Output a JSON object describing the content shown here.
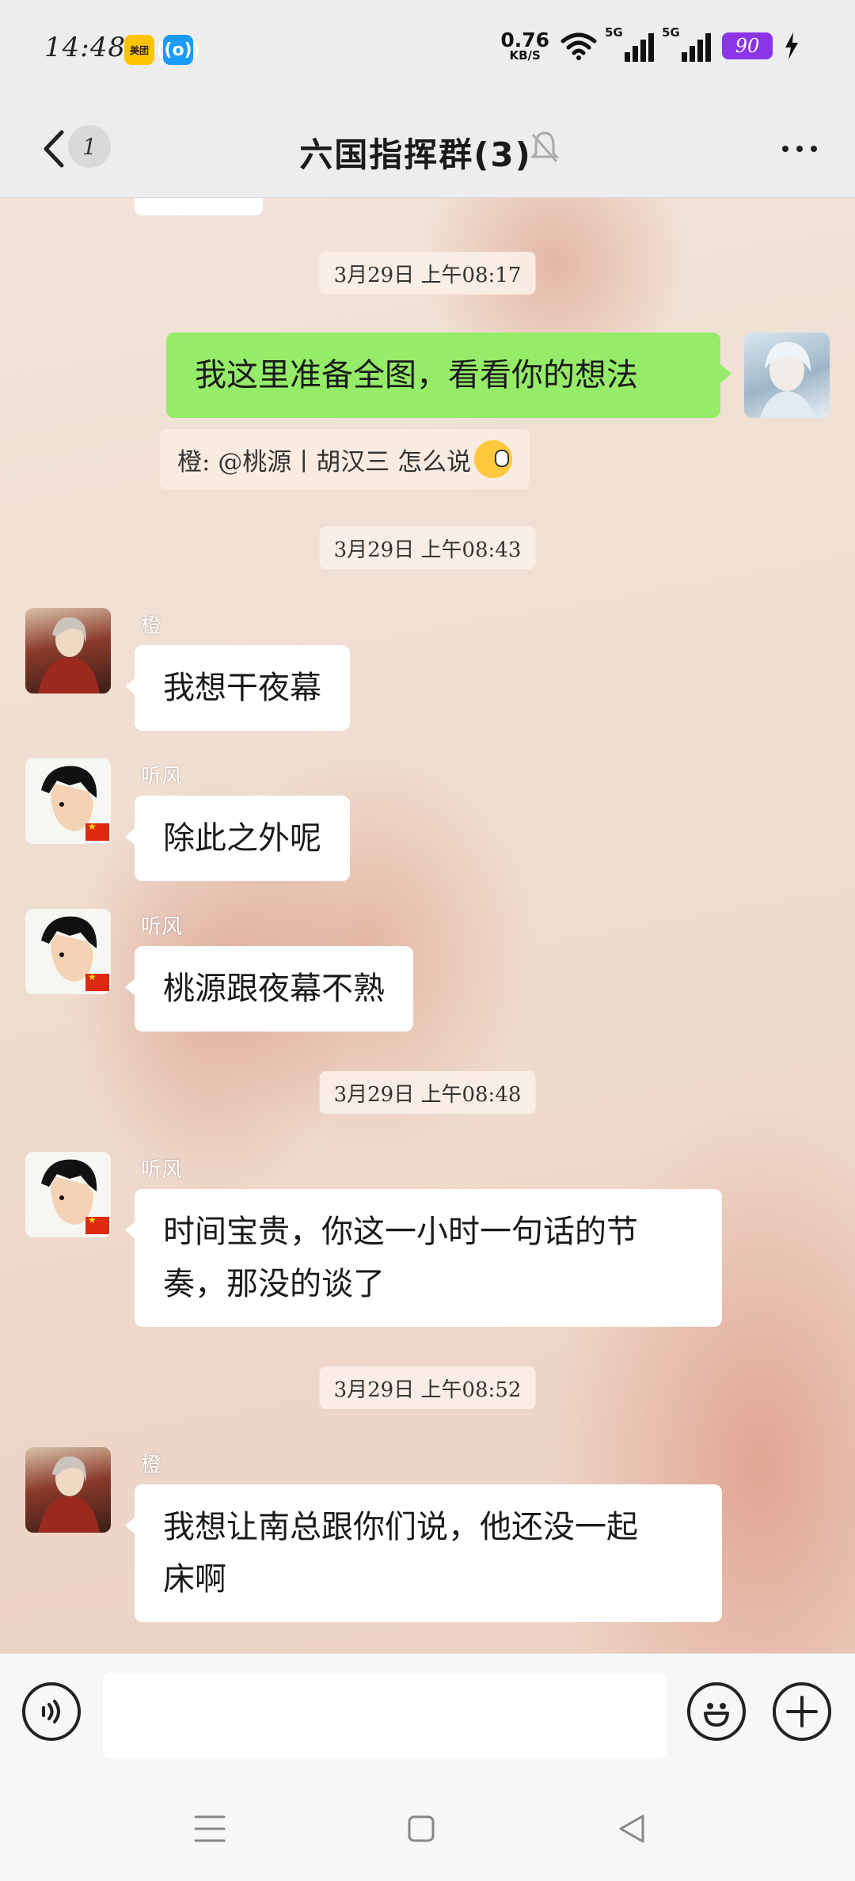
{
  "status_bar": {
    "time": "14:48",
    "app_badges": [
      "美团",
      "((o))"
    ],
    "net_speed_value": "0.76",
    "net_speed_unit": "KB/S",
    "signal_1": "5G",
    "signal_2": "5G",
    "battery": "90"
  },
  "header": {
    "unread_count": "1",
    "title": "六国指挥群(3)"
  },
  "messages": {
    "ts1": "3月29日 上午08:17",
    "m1_text": "我这里准备全图，看看你的想法",
    "m1_quote": "橙: @桃源丨胡汉三 怎么说",
    "ts2": "3月29日 上午08:43",
    "m2_sender": "橙",
    "m2_text": "我想干夜幕",
    "m3_sender": "听风",
    "m3_text": "除此之外呢",
    "m4_sender": "听风",
    "m4_text": "桃源跟夜幕不熟",
    "ts3": "3月29日 上午08:48",
    "m5_sender": "听风",
    "m5_line1": "时间宝贵，你这一小时一句话的节",
    "m5_line2": "奏，那没的谈了",
    "ts4": "3月29日 上午08:52",
    "m6_sender": "橙",
    "m6_line1": "我想让南总跟你们说，他还没一起",
    "m6_line2": "床啊"
  },
  "input": {
    "placeholder": ""
  },
  "colors": {
    "self_bubble": "#95ec69",
    "battery": "#8a35e8",
    "status_bg": "#ededed"
  }
}
